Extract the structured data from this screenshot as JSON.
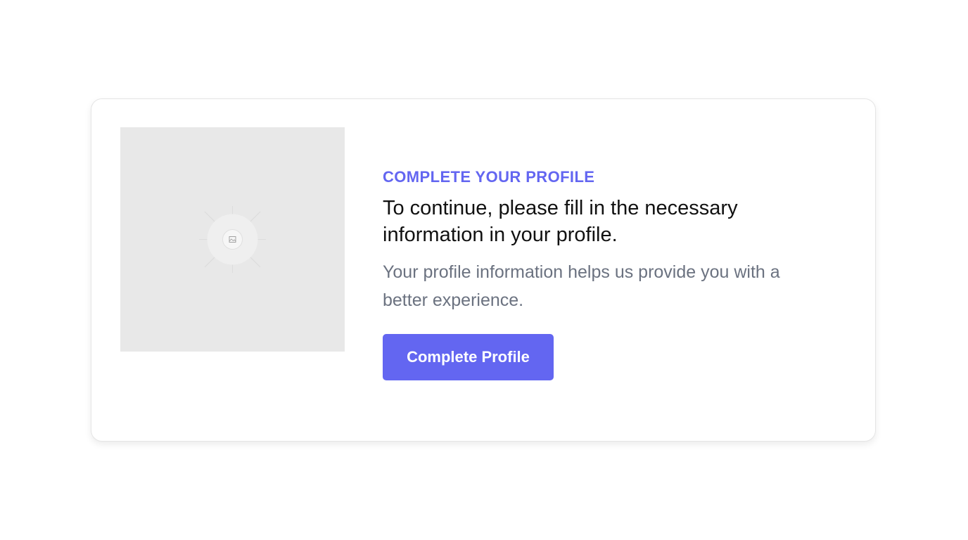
{
  "card": {
    "eyebrow": "COMPLETE YOUR PROFILE",
    "heading": "To continue, please fill in the necessary information in your profile.",
    "subtext": "Your profile information helps us provide you with a better experience.",
    "cta_label": "Complete Profile"
  },
  "image": {
    "icon": "image-placeholder-icon"
  },
  "colors": {
    "accent": "#6366f1",
    "heading": "#111111",
    "muted": "#6b7280",
    "placeholder_bg": "#e8e8e8"
  }
}
